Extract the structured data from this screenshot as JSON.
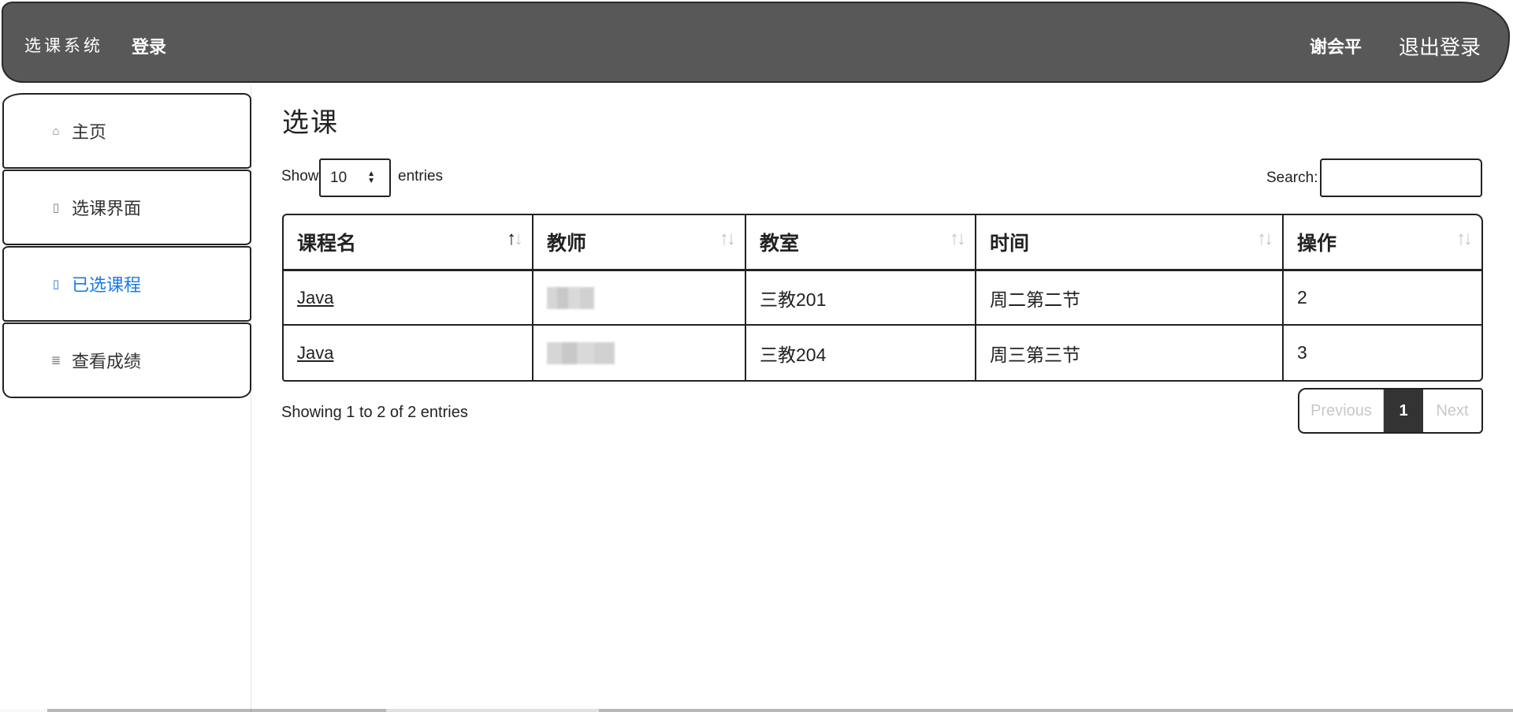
{
  "navbar": {
    "brand": "选课系统",
    "login_link": "登录",
    "user_name": "谢会平",
    "logout_link": "退出登录"
  },
  "sidebar": {
    "items": [
      {
        "label": "主页",
        "icon": "home-icon",
        "active": false
      },
      {
        "label": "选课界面",
        "icon": "book-icon",
        "active": false
      },
      {
        "label": "已选课程",
        "icon": "book-icon",
        "active": true
      },
      {
        "label": "查看成绩",
        "icon": "list-icon",
        "active": false
      }
    ],
    "active_color": "#1a7ae8"
  },
  "main": {
    "title": "选课",
    "length": {
      "prefix": "Show",
      "value": "10",
      "suffix": "entries"
    },
    "search": {
      "label": "Search:",
      "value": ""
    },
    "table": {
      "columns": [
        "课程名",
        "教师",
        "教室",
        "时间",
        "操作"
      ],
      "sorted_column": "课程名",
      "sort_direction": "asc",
      "rows": [
        {
          "course": "Java",
          "teacher": "(redacted)",
          "classroom": "三教201",
          "time": "周二第二节",
          "action": "2"
        },
        {
          "course": "Java",
          "teacher": "(redacted)",
          "classroom": "三教204",
          "time": "周三第三节",
          "action": "3"
        }
      ]
    },
    "info": "Showing 1 to 2 of 2 entries",
    "pagination": {
      "previous": "Previous",
      "current": "1",
      "next": "Next"
    }
  },
  "colors": {
    "navbar_bg": "#585858",
    "active_page_bg": "#333333"
  }
}
